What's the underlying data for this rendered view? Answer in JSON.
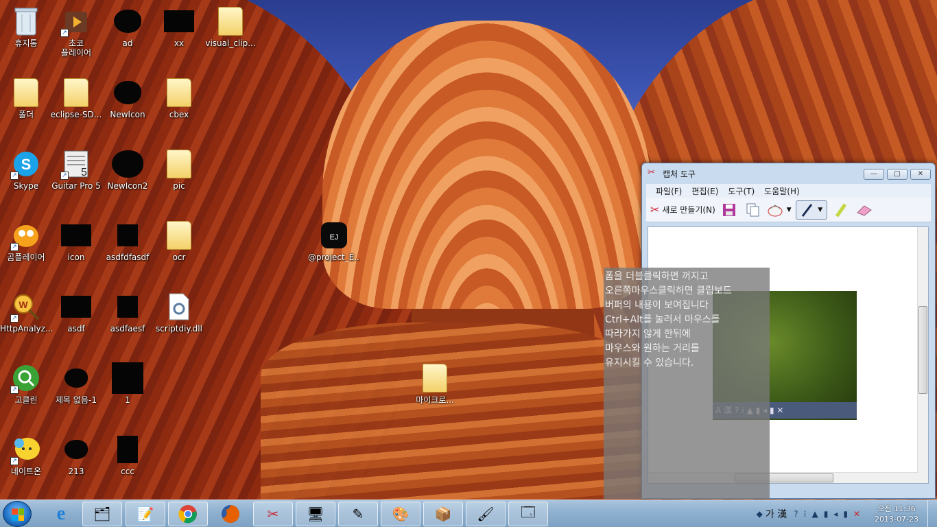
{
  "desktop": {
    "icons": [
      {
        "label": "휴지통",
        "icon": "recycle-bin-icon"
      },
      {
        "label": "초코\n플레이어",
        "icon": "media-player-icon"
      },
      {
        "label": "ad",
        "icon": "image-file-icon"
      },
      {
        "label": "xx",
        "icon": "image-file-icon"
      },
      {
        "label": "visual_clip...",
        "icon": "folder-icon"
      },
      {
        "label": "폴더",
        "icon": "folder-icon"
      },
      {
        "label": "eclipse-SD...",
        "icon": "folder-icon"
      },
      {
        "label": "NewIcon",
        "icon": "image-file-icon"
      },
      {
        "label": "cbex",
        "icon": "folder-icon"
      },
      {
        "label": "Skype",
        "icon": "skype-icon"
      },
      {
        "label": "Guitar Pro 5",
        "icon": "guitar-pro-icon"
      },
      {
        "label": "NewIcon2",
        "icon": "image-file-icon"
      },
      {
        "label": "pic",
        "icon": "folder-icon"
      },
      {
        "label": "곰플레이어",
        "icon": "gom-player-icon"
      },
      {
        "label": "icon",
        "icon": "image-file-icon"
      },
      {
        "label": "asdfdfasdf",
        "icon": "image-file-icon"
      },
      {
        "label": "ocr",
        "icon": "folder-icon"
      },
      {
        "label": "@project_E...",
        "icon": "project-logo-icon"
      },
      {
        "label": "HttpAnalyz...",
        "icon": "http-analyzer-icon"
      },
      {
        "label": "asdf",
        "icon": "image-file-icon"
      },
      {
        "label": "asdfaesf",
        "icon": "image-file-icon"
      },
      {
        "label": "scriptdiy.dll",
        "icon": "dll-file-icon"
      },
      {
        "label": "고클린",
        "icon": "goclean-icon"
      },
      {
        "label": "제목 없음-1",
        "icon": "image-file-icon"
      },
      {
        "label": "1",
        "icon": "image-file-icon"
      },
      {
        "label": "마이크로...",
        "icon": "folder-icon"
      },
      {
        "label": "네이트온",
        "icon": "nateon-icon"
      },
      {
        "label": "213",
        "icon": "image-file-icon"
      },
      {
        "label": "ccc",
        "icon": "image-file-icon"
      }
    ]
  },
  "snipping_tool": {
    "title": "캡처 도구",
    "window_buttons": {
      "minimize": "—",
      "maximize": "□",
      "close": "✕"
    },
    "menu": [
      "파일(F)",
      "편집(E)",
      "도구(T)",
      "도움말(H)"
    ],
    "toolbar": {
      "new_label": "새로 만들기(N)",
      "save_icon": "save-icon",
      "copy_icon": "copy-icon",
      "send_icon": "send-snip-icon",
      "pen_icon": "pen-icon",
      "highlighter_icon": "highlighter-icon",
      "eraser_icon": "eraser-icon"
    },
    "captured_bar_text": "A 漢 ? ⁞ ▲ ▮ ◂ ▮ ✕"
  },
  "overlay": {
    "lines": [
      "폼을 더블클릭하면 꺼지고",
      "오른쪽마우스클릭하면 클립보드",
      "버퍼의 내용이 보여집니다",
      "Ctrl+Alt를 눌러서 마우스를",
      "따라가지 않게 한뒤에",
      "마우스와 원하는 거리를",
      "유지시킬 수 있습니다."
    ]
  },
  "taskbar": {
    "apps": [
      "ie-icon",
      "explorer-icon",
      "notepad-icon",
      "chrome-icon",
      "firefox-icon",
      "snipping-tool-icon",
      "control-panel-icon",
      "editor-icon",
      "paint-bucket-icon",
      "installer-icon",
      "paint-icon",
      "window-icon"
    ],
    "tray": {
      "ime": "가 漢",
      "time": "오전 11:36",
      "date": "2013-07-23"
    }
  }
}
